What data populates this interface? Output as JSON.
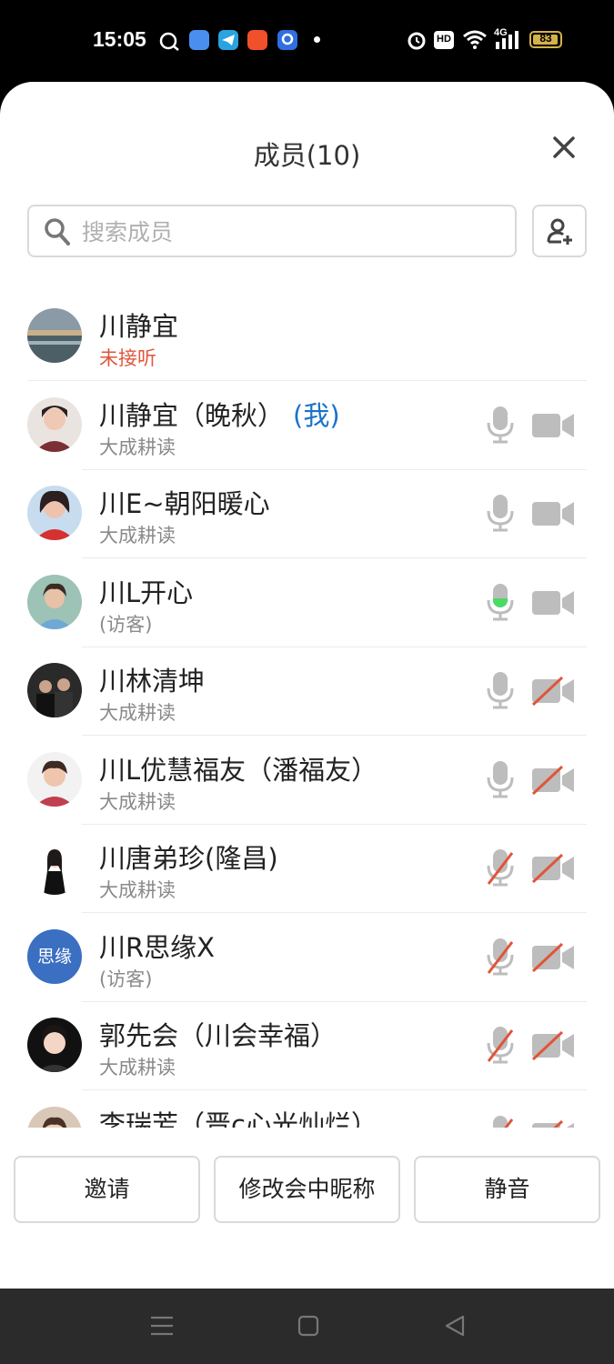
{
  "status_bar": {
    "time": "15:05",
    "icons": [
      "chat-bubble-icon",
      "blue-app-icon",
      "telegram-icon",
      "orange-app-icon",
      "blue-app2-icon",
      "dot-icon"
    ],
    "right_icons": [
      "alarm-icon",
      "hd-icon",
      "wifi-icon",
      "signal-4g-icon"
    ],
    "hd_label": "HD",
    "network_label": "4G",
    "battery": "83",
    "colors": {
      "battery": "#d4b24a"
    }
  },
  "panel": {
    "title": "成员(10)",
    "search_placeholder": "搜索成员"
  },
  "members": [
    {
      "name": "川静宜",
      "me_tag": "",
      "subtitle": "未接听",
      "status_color": "#e0553a",
      "avatar": "lake",
      "mic": "none",
      "cam": "none"
    },
    {
      "name": "川静宜（晚秋）",
      "me_tag": "(我)",
      "subtitle": "大成耕读",
      "avatar": "woman1",
      "mic": "on",
      "cam": "on"
    },
    {
      "name": "川E~朝阳暖心",
      "me_tag": "",
      "subtitle": "大成耕读",
      "avatar": "woman2",
      "mic": "on",
      "cam": "on"
    },
    {
      "name": "川L开心",
      "me_tag": "",
      "subtitle": "(访客)",
      "avatar": "woman3",
      "mic": "speaking",
      "cam": "on"
    },
    {
      "name": "川林清坤",
      "me_tag": "",
      "subtitle": "大成耕读",
      "avatar": "group",
      "mic": "on",
      "cam": "off"
    },
    {
      "name": "川L优慧福友（潘福友）",
      "me_tag": "",
      "subtitle": "大成耕读",
      "avatar": "woman4",
      "mic": "on",
      "cam": "off"
    },
    {
      "name": "川唐弟珍(隆昌)",
      "me_tag": "",
      "subtitle": "大成耕读",
      "avatar": "woman5",
      "mic": "off",
      "cam": "off"
    },
    {
      "name": "川R思缘X",
      "me_tag": "",
      "subtitle": "(访客)",
      "avatar_text": "思缘",
      "avatar": "text",
      "mic": "off",
      "cam": "off"
    },
    {
      "name": "郭先会（川会幸福）",
      "me_tag": "",
      "subtitle": "大成耕读",
      "avatar": "woman6",
      "mic": "off",
      "cam": "off"
    },
    {
      "name": "李瑞芳（晋c心光灿烂）",
      "me_tag": "",
      "subtitle": "",
      "avatar": "woman7",
      "mic": "off",
      "cam": "off"
    }
  ],
  "buttons": {
    "invite": "邀请",
    "rename": "修改会中昵称",
    "mute": "静音"
  },
  "colors": {
    "accent": "#1a73c9",
    "avatar_text_bg": "#3a6fc2",
    "icon_gray": "#bdbdbd",
    "icon_off_slash": "#e0553a",
    "speaking_green": "#4cd964"
  },
  "nav_bar": {
    "icons": [
      "menu-icon",
      "home-square-icon",
      "back-triangle-icon"
    ]
  }
}
